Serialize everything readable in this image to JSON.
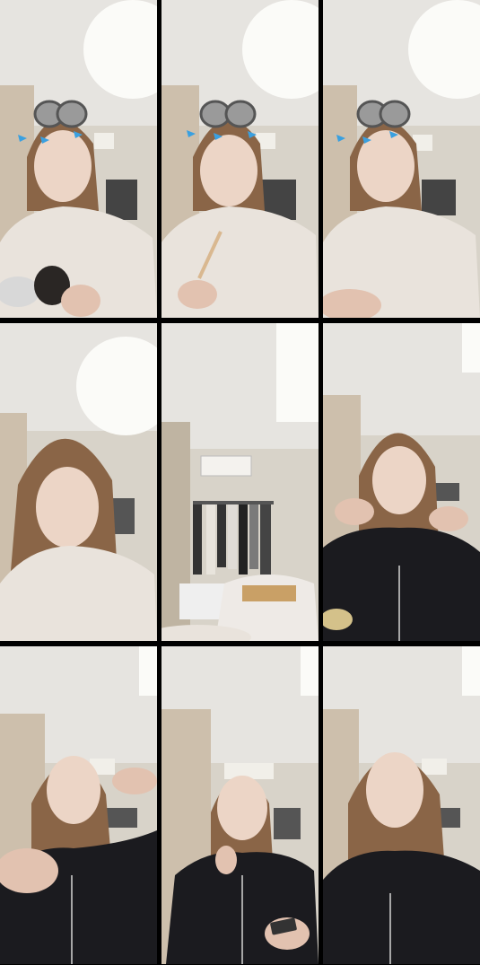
{
  "grid": {
    "rows": 3,
    "cols": 3
  },
  "frames": [
    {
      "id": 1,
      "scene": "filter-rollers-light-top",
      "top_color": "white",
      "holding": "mirror"
    },
    {
      "id": 2,
      "scene": "filter-rollers-light-top",
      "top_color": "white",
      "holding": "makeup-brush"
    },
    {
      "id": 3,
      "scene": "filter-rollers-light-top",
      "top_color": "white",
      "holding": "none"
    },
    {
      "id": 4,
      "scene": "hair-down-light-top",
      "top_color": "white",
      "holding": "none"
    },
    {
      "id": 5,
      "scene": "room-closet-wall",
      "top_color": "none",
      "holding": "none"
    },
    {
      "id": 6,
      "scene": "black-zip-top-arms-up",
      "top_color": "black",
      "holding": "none"
    },
    {
      "id": 7,
      "scene": "black-zip-top-arm-raised",
      "top_color": "black",
      "holding": "none"
    },
    {
      "id": 8,
      "scene": "black-zip-top-phone",
      "top_color": "black",
      "holding": "phone"
    },
    {
      "id": 9,
      "scene": "black-zip-top-portrait",
      "top_color": "black",
      "holding": "none"
    }
  ],
  "colors": {
    "background": "#000000",
    "wall": "#d9d4ca",
    "ceiling": "#e9e7e3",
    "curtain": "#cfc3b1",
    "skin": "#e9d0c0",
    "hair": "#8a6547",
    "white_top": "#e8e2da",
    "black_top": "#1b1b1f"
  }
}
